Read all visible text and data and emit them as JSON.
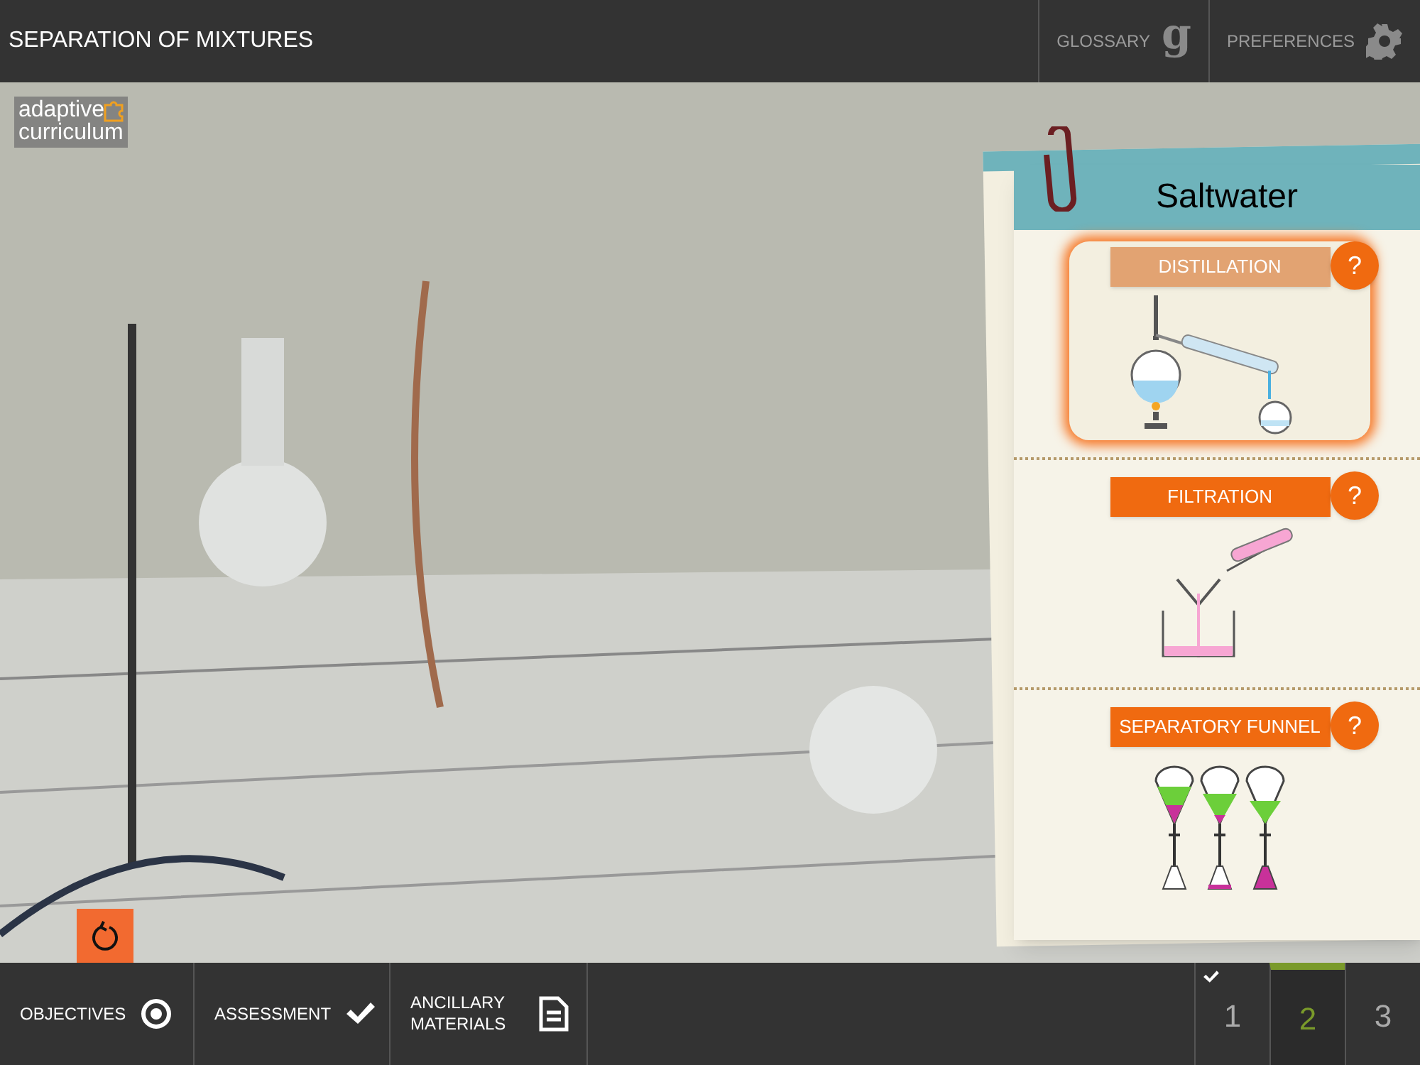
{
  "window": {
    "title": "SEPARATION OF MIXTURES"
  },
  "header_buttons": [
    {
      "label": "GLOSSARY",
      "kind": "glossary",
      "icon_text": "g"
    },
    {
      "label": "PREFERENCES",
      "kind": "preferences"
    }
  ],
  "logo": {
    "line_1": "adaptive",
    "line_2": "curriculum"
  },
  "card": {
    "title": "Saltwater",
    "methods": [
      {
        "label": "DISTILLATION",
        "kind": "distillation",
        "selected": true,
        "help": "?"
      },
      {
        "label": "FILTRATION",
        "kind": "filtration",
        "selected": false,
        "help": "?"
      },
      {
        "label": "SEPARATORY FUNNEL",
        "kind": "funnel",
        "selected": false,
        "help": "?"
      }
    ]
  },
  "bottom_nav": [
    {
      "label": "OBJECTIVES",
      "kind": "objectives"
    },
    {
      "label": "ASSESSMENT",
      "kind": "assessment"
    },
    {
      "label": "ANCILLARY MATERIALS",
      "kind": "materials"
    }
  ],
  "pages": [
    {
      "label": "1",
      "selected": false,
      "completed": true
    },
    {
      "label": "2",
      "selected": true,
      "completed": false
    },
    {
      "label": "3",
      "selected": false,
      "completed": false
    }
  ]
}
